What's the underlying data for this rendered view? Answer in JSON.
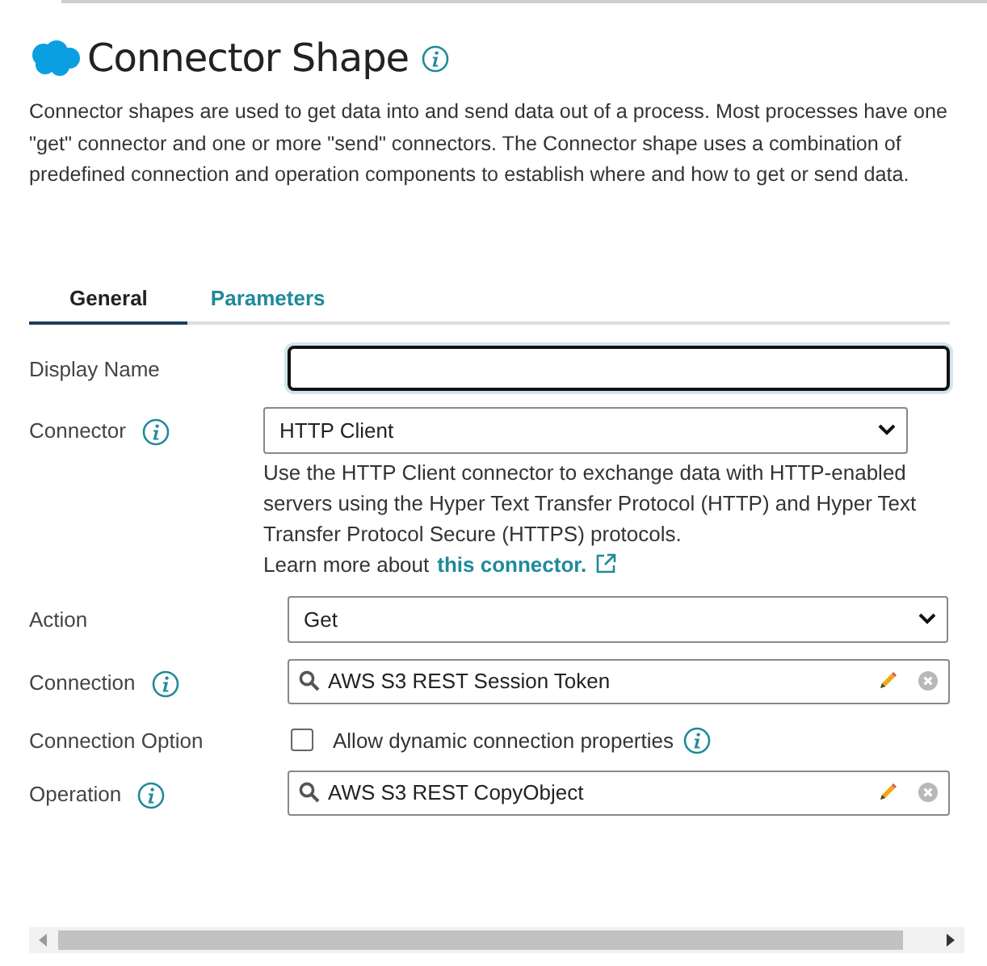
{
  "header": {
    "title": "Connector Shape",
    "description": "Connector shapes are used to get data into and send data out of a process. Most processes have one \"get\" connector and one or more \"send\" connectors. The Connector shape uses a combination of predefined connection and operation components to establish where and how to get or send data."
  },
  "tabs": [
    {
      "label": "General",
      "selected": true
    },
    {
      "label": "Parameters",
      "selected": false
    }
  ],
  "fields": [
    {
      "kind": "text",
      "label": "Display Name",
      "info": false,
      "focused": true
    },
    {
      "kind": "select",
      "label": "Connector",
      "info": true,
      "value": "HTTP Client",
      "help": "Use the HTTP Client connector to exchange data with HTTP-enabled servers using the Hyper Text Transfer Protocol (HTTP) and Hyper Text Transfer Protocol Secure (HTTPS) protocols.",
      "learn_more": "Learn more about",
      "link": "this connector."
    },
    {
      "kind": "select",
      "label": "Action",
      "info": false,
      "value": "Get"
    },
    {
      "kind": "lookup",
      "label": "Connection",
      "info": true,
      "value": "AWS S3 REST Session Token"
    },
    {
      "kind": "checkbox",
      "label": "Connection Option",
      "info": false,
      "option": "Allow dynamic connection properties",
      "checked": false,
      "option_info": true
    },
    {
      "kind": "lookup",
      "label": "Operation",
      "info": true,
      "value": "AWS S3 REST CopyObject"
    }
  ]
}
